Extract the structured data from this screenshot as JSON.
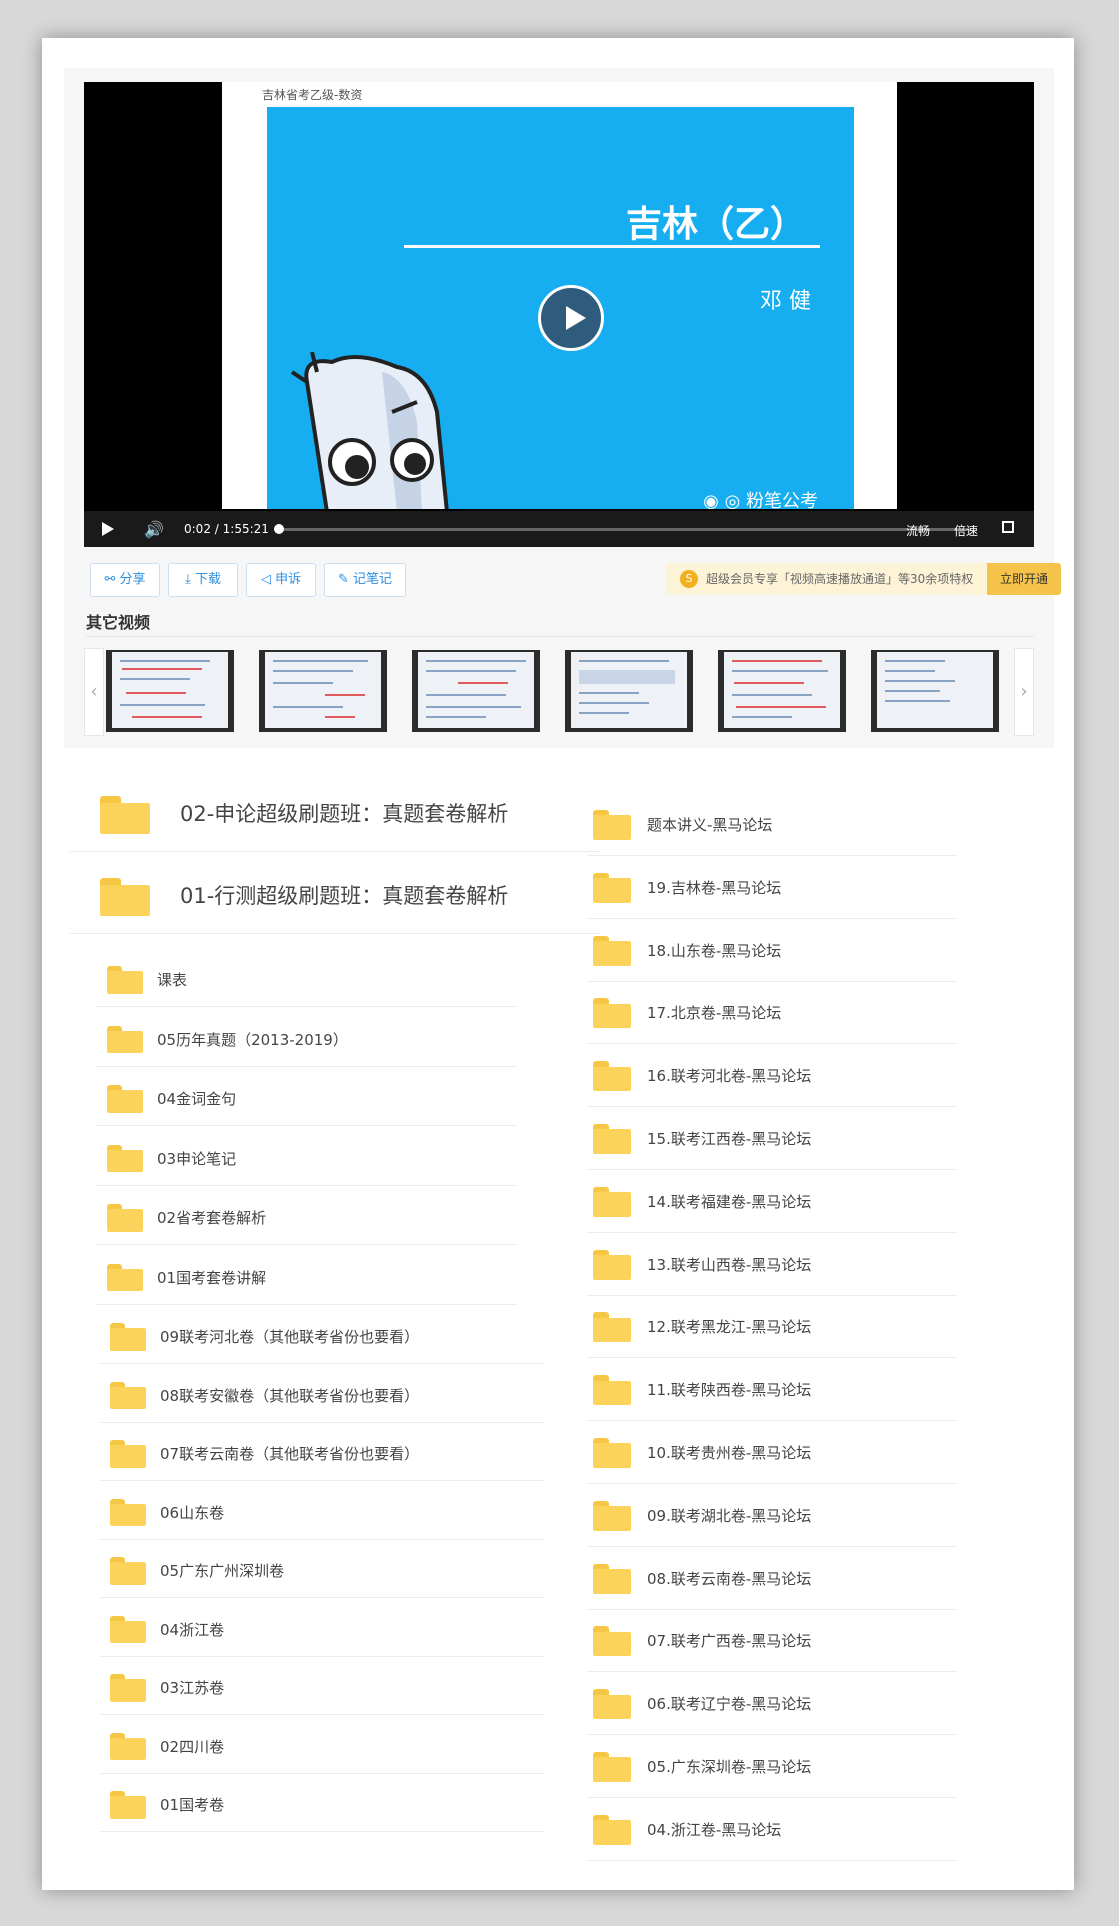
{
  "player": {
    "slide_caption": "吉林省考乙级-数资",
    "slide_title": "吉林（乙）",
    "slide_author": "邓 健",
    "slide_brand": "粉笔公考",
    "time_current": "0:02",
    "time_separator": "/",
    "time_total": "1:55:21",
    "quality": "流畅",
    "speed": "倍速"
  },
  "toolbar": {
    "share": "分享",
    "download": "下载",
    "complain": "申诉",
    "note": "记笔记",
    "vip_text": "超级会员专享「视频高速播放通道」等30余项特权",
    "vip_button": "立即开通",
    "vip_icon": "S"
  },
  "other_videos": {
    "title": "其它视频",
    "prev": "‹",
    "next": "›"
  },
  "folders_big": [
    "02-申论超级刷题班：真题套卷解析",
    "01-行测超级刷题班：真题套卷解析"
  ],
  "folders_left_a": [
    "课表",
    "05历年真题（2013-2019）",
    "04金词金句",
    "03申论笔记",
    "02省考套卷解析",
    "01国考套卷讲解"
  ],
  "folders_left_b": [
    "09联考河北卷（其他联考省份也要看）",
    "08联考安徽卷（其他联考省份也要看）",
    "07联考云南卷（其他联考省份也要看）",
    "06山东卷",
    "05广东广州深圳卷",
    "04浙江卷",
    "03江苏卷",
    "02四川卷",
    "01国考卷"
  ],
  "folders_right": [
    "题本讲义-黑马论坛",
    "19.吉林卷-黑马论坛",
    "18.山东卷-黑马论坛",
    "17.北京卷-黑马论坛",
    "16.联考河北卷-黑马论坛",
    "15.联考江西卷-黑马论坛",
    "14.联考福建卷-黑马论坛",
    "13.联考山西卷-黑马论坛",
    "12.联考黑龙江-黑马论坛",
    "11.联考陕西卷-黑马论坛",
    "10.联考贵州卷-黑马论坛",
    "09.联考湖北卷-黑马论坛",
    "08.联考云南卷-黑马论坛",
    "07.联考广西卷-黑马论坛",
    "06.联考辽宁卷-黑马论坛",
    "05.广东深圳卷-黑马论坛",
    "04.浙江卷-黑马论坛"
  ],
  "colors": {
    "slide_blue": "#16aef0",
    "folder_yellow": "#fbd35a",
    "link_blue": "#2d8fe0",
    "vip_gold": "#f5c24a"
  }
}
